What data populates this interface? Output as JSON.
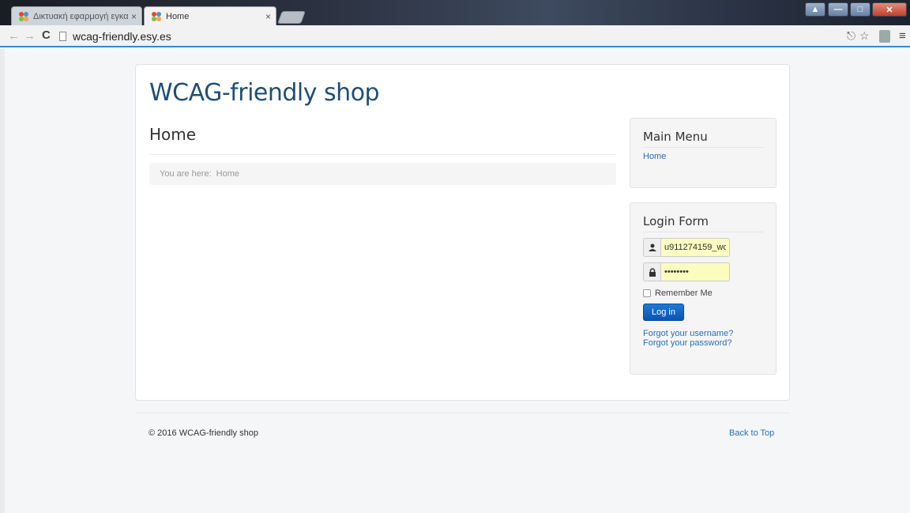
{
  "browser": {
    "tabs": [
      {
        "title": "Δικτυακή εφαρμογή εγκα",
        "active": false
      },
      {
        "title": "Home",
        "active": true
      }
    ],
    "tab_close_glyph": "×",
    "url": "wcag-friendly.esy.es",
    "icons": [
      "back-icon",
      "forward-icon",
      "reload-icon",
      "page-icon",
      "key-icon",
      "star-icon",
      "extension-icon",
      "menu-icon"
    ]
  },
  "site": {
    "title": "WCAG-friendly shop",
    "title_color": "#1f4f74",
    "link_color": "#2a6fb5"
  },
  "content": {
    "page_title": "Home",
    "breadcrumb_label": "You are here:",
    "breadcrumb_current": "Home"
  },
  "main_menu": {
    "title": "Main Menu",
    "items": [
      {
        "label": "Home"
      }
    ]
  },
  "login_form": {
    "title": "Login Form",
    "username_value": "u911274159_wc",
    "password_value": "••••••••",
    "remember_label": "Remember Me",
    "remember_checked": false,
    "submit_label": "Log in",
    "forgot_username": "Forgot your username?",
    "forgot_password": "Forgot your password?"
  },
  "footer": {
    "copyright": "© 2016 WCAG-friendly shop",
    "back_to_top": "Back to Top"
  }
}
